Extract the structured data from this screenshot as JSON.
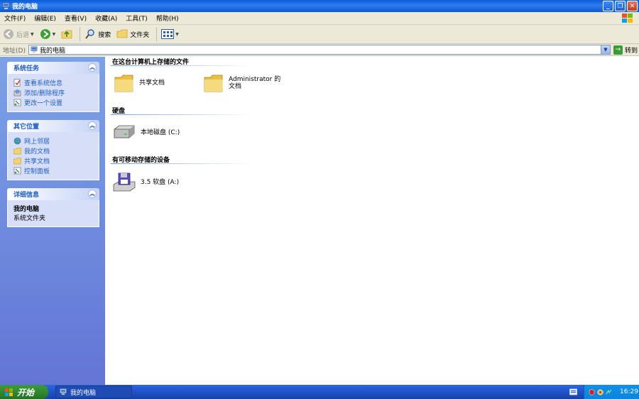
{
  "window": {
    "title": "我的电脑",
    "minimize": "_",
    "maximize": "❐",
    "close": "✕"
  },
  "menu": [
    "文件(F)",
    "编辑(E)",
    "查看(V)",
    "收藏(A)",
    "工具(T)",
    "帮助(H)"
  ],
  "toolbar": {
    "back_label": "后退",
    "search_label": "搜索",
    "folders_label": "文件夹"
  },
  "address": {
    "label": "地址(D)",
    "value": "我的电脑",
    "go_label": "转到",
    "go_icon_glyph": "→",
    "dropdown_glyph": "▼"
  },
  "sidebar": {
    "collapse_glyph": "︽",
    "system_tasks": {
      "title": "系统任务",
      "items": [
        "查看系统信息",
        "添加/删除程序",
        "更改一个设置"
      ]
    },
    "other_places": {
      "title": "其它位置",
      "items": [
        "网上邻居",
        "我的文档",
        "共享文档",
        "控制面板"
      ]
    },
    "details": {
      "title": "详细信息",
      "name": "我的电脑",
      "type": "系统文件夹"
    }
  },
  "main": {
    "groups": [
      {
        "title": "在这台计算机上存储的文件",
        "items": [
          "共享文档",
          "Administrator 的文档"
        ]
      },
      {
        "title": "硬盘",
        "items": [
          "本地磁盘 (C:)"
        ]
      },
      {
        "title": "有可移动存储的设备",
        "items": [
          "3.5 软盘 (A:)"
        ]
      }
    ]
  },
  "taskbar": {
    "start_label": "开始",
    "task_label": "我的电脑",
    "clock": "16:29"
  },
  "colors": {
    "title_bar": "#0a5cd9",
    "sidebar_bg": "#6f8fe0",
    "link_blue": "#215dc6",
    "start_green": "#2f8a2f",
    "tray_blue": "#0d83dd"
  }
}
